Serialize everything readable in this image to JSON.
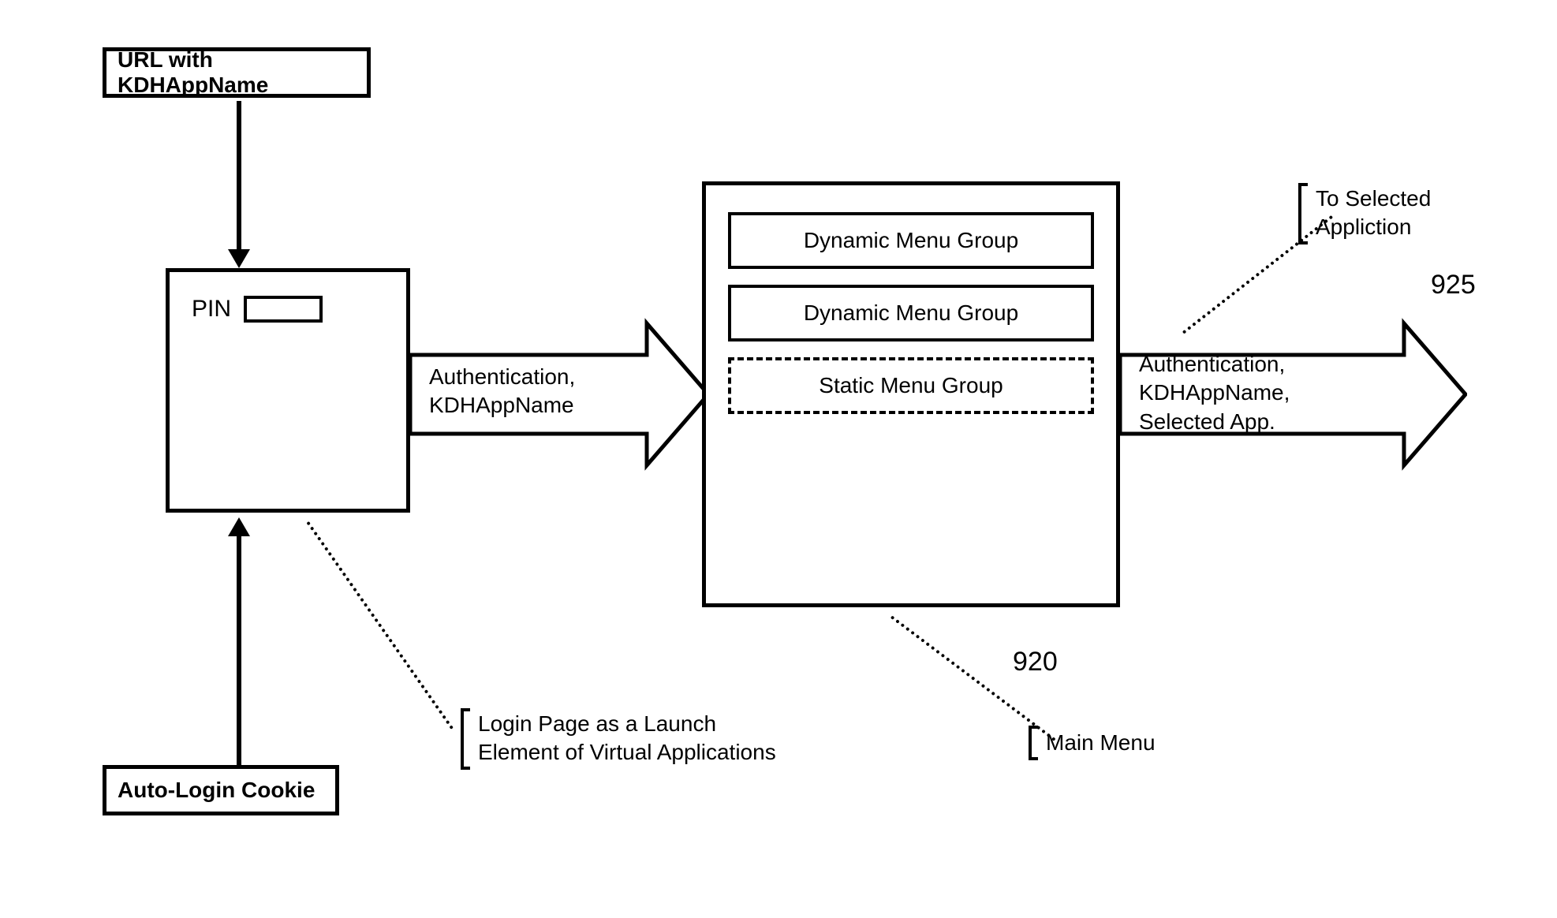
{
  "boxes": {
    "url": "URL with KDHAppName",
    "cookie": "Auto-Login Cookie",
    "pin_label": "PIN"
  },
  "menu": {
    "item1": "Dynamic Menu Group",
    "item2": "Dynamic Menu Group",
    "item3": "Static Menu Group"
  },
  "arrows": {
    "a1_line1": "Authentication,",
    "a1_line2": "KDHAppName",
    "a2_line1": "Authentication,",
    "a2_line2": "KDHAppName,",
    "a2_line3": "Selected App."
  },
  "annotations": {
    "login_l1": "Login Page as a Launch",
    "login_l2": "Element of Virtual Applications",
    "mainmenu": "Main Menu",
    "to_sel_l1": "To Selected",
    "to_sel_l2": "Appliction"
  },
  "refs": {
    "r920": "920",
    "r925": "925"
  }
}
